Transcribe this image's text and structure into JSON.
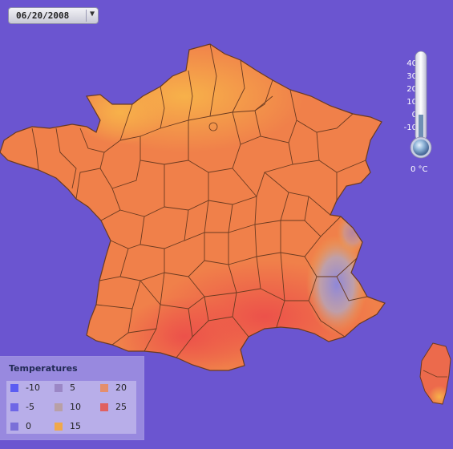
{
  "date_selector": {
    "value": "06/20/2008",
    "icon": "chevron-down-icon"
  },
  "thermometer": {
    "ticks": [
      "40",
      "30",
      "20",
      "10",
      "0",
      "-10"
    ],
    "reading": "0 °C",
    "fill_level_celsius": 0
  },
  "legend": {
    "title": "Temperatures",
    "items": [
      {
        "label": "-10",
        "color": "#5b5cf2"
      },
      {
        "label": "-5",
        "color": "#6e66e6"
      },
      {
        "label": "0",
        "color": "#7a6fd8"
      },
      {
        "label": "5",
        "color": "#9b87c6"
      },
      {
        "label": "10",
        "color": "#b8a0a6"
      },
      {
        "label": "15",
        "color": "#f0a84a"
      },
      {
        "label": "20",
        "color": "#e48e6c"
      },
      {
        "label": "25",
        "color": "#e06060"
      }
    ]
  },
  "colors": {
    "background": "#6b55d0",
    "map_base": "#f0804a",
    "map_north": "#f6a548",
    "map_south": "#ee5a4a",
    "alps_cold": "#8f87d8",
    "borders": "#6a3a20"
  }
}
